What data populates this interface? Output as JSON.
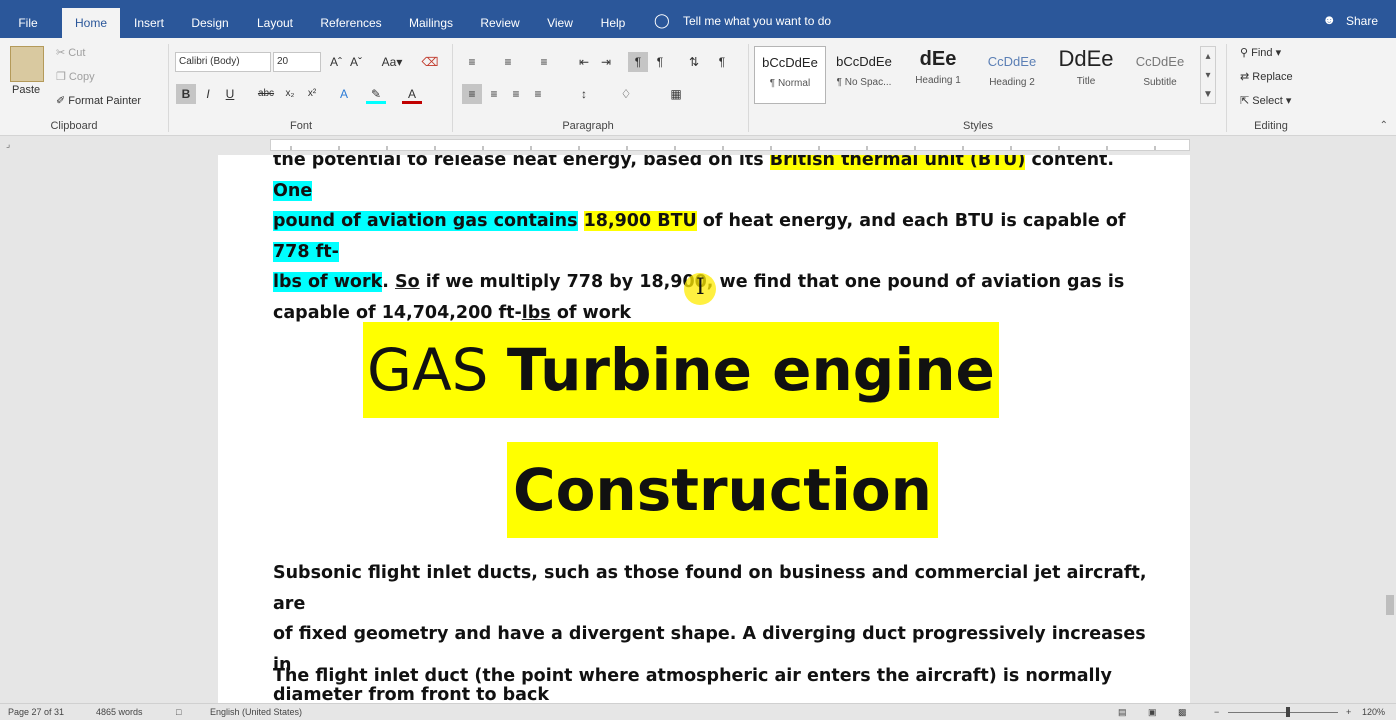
{
  "tabs": [
    "File",
    "Home",
    "Insert",
    "Design",
    "Layout",
    "References",
    "Mailings",
    "Review",
    "View",
    "Help"
  ],
  "active_tab": "Home",
  "tell_me": "Tell me what you want to do",
  "share": "Share",
  "clipboard": {
    "paste": "Paste",
    "cut": "Cut",
    "copy": "Copy",
    "format_painter": "Format Painter",
    "group_label": "Clipboard"
  },
  "font": {
    "name": "Calibri (Body)",
    "size": "20",
    "group_label": "Font"
  },
  "paragraph": {
    "group_label": "Paragraph"
  },
  "styles": {
    "items": [
      {
        "sample": "bCcDdEe",
        "name": "¶ Normal"
      },
      {
        "sample": "bCcDdEe",
        "name": "¶ No Spac..."
      },
      {
        "sample": "dEe",
        "name": "Heading 1"
      },
      {
        "sample": "CcDdEe",
        "name": "Heading 2"
      },
      {
        "sample": "DdEe",
        "name": "Title"
      },
      {
        "sample": "CcDdEe",
        "name": "Subtitle"
      }
    ],
    "group_label": "Styles"
  },
  "editing": {
    "find": "Find",
    "replace": "Replace",
    "select": "Select",
    "group_label": "Editing"
  },
  "doc": {
    "p1_l1_a": "the potential to release heat energy, based on its ",
    "p1_l1_b": "British thermal unit (BTU)",
    "p1_l1_c": " content. ",
    "p1_l1_d": "One",
    "p1_l2_a": "pound of aviation gas contains",
    "p1_l2_b": " ",
    "p1_l2_c": "18,900 BTU",
    "p1_l2_d": " of heat energy, and each BTU is capable of ",
    "p1_l2_e": "778 ft-",
    "p1_l3_a": "lbs of work",
    "p1_l3_b": ". ",
    "p1_l3_c": "So",
    "p1_l3_d": " if we multiply 778 by 18,900, we find that one pound of aviation gas is",
    "p1_l4_a": "capable of 14,704,200 ft-",
    "p1_l4_b": "lbs",
    "p1_l4_c": " of work",
    "heading_light": "GAS ",
    "heading_bold": "Turbine engine",
    "heading2": "Construction",
    "p2_l1": "Subsonic flight inlet ducts, such as those found on business and commercial jet aircraft, are",
    "p2_l2": "of fixed geometry and have a divergent shape. A diverging duct progressively increases in",
    "p2_l3": "diameter from front to back",
    "p3_l1": "The flight inlet duct (the point where atmospheric air enters the aircraft) is normally"
  },
  "status": {
    "page": "Page 27 of 31",
    "words": "4865 words",
    "language": "English (United States)",
    "zoom": "120%"
  }
}
